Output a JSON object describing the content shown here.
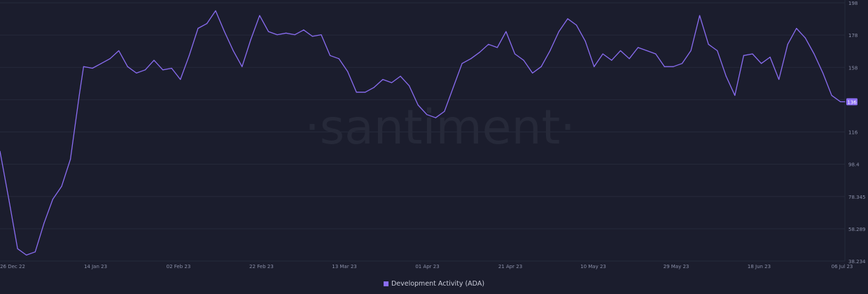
{
  "watermark": "·santiment·",
  "colors": {
    "series": "#8a6df2",
    "background": "#1b1d2d",
    "grid": "#262a3b",
    "text": "#8a8fa8",
    "last_value_bg": "#8a6df2"
  },
  "chart_data": {
    "type": "line",
    "title": "",
    "xlabel": "",
    "ylabel": "",
    "ylim": [
      36.234,
      198
    ],
    "y_ticks": [
      "198",
      "178",
      "158",
      "138",
      "116",
      "98.4",
      "78.345",
      "58.289",
      "38.234"
    ],
    "x_ticks": [
      "26 Dec 22",
      "14 Jan 23",
      "02 Feb 23",
      "22 Feb 23",
      "13 Mar 23",
      "01 Apr 23",
      "21 Apr 23",
      "10 May 23",
      "29 May 23",
      "18 Jun 23",
      "06 Jul 23"
    ],
    "last_value_label": "136",
    "legend_position": "bottom-center",
    "grid": true,
    "series": [
      {
        "name": "Development Activity (ADA)",
        "x": [
          "2022-12-26",
          "2022-12-28",
          "2022-12-30",
          "2023-01-01",
          "2023-01-03",
          "2023-01-05",
          "2023-01-07",
          "2023-01-09",
          "2023-01-11",
          "2023-01-13",
          "2023-01-14",
          "2023-01-16",
          "2023-01-18",
          "2023-01-20",
          "2023-01-22",
          "2023-01-24",
          "2023-01-26",
          "2023-01-28",
          "2023-01-30",
          "2023-02-01",
          "2023-02-03",
          "2023-02-05",
          "2023-02-07",
          "2023-02-09",
          "2023-02-11",
          "2023-02-13",
          "2023-02-15",
          "2023-02-17",
          "2023-02-19",
          "2023-02-21",
          "2023-02-23",
          "2023-02-25",
          "2023-02-27",
          "2023-03-01",
          "2023-03-03",
          "2023-03-05",
          "2023-03-07",
          "2023-03-09",
          "2023-03-11",
          "2023-03-13",
          "2023-03-15",
          "2023-03-17",
          "2023-03-19",
          "2023-03-21",
          "2023-03-23",
          "2023-03-25",
          "2023-03-27",
          "2023-03-29",
          "2023-03-31",
          "2023-04-02",
          "2023-04-04",
          "2023-04-06",
          "2023-04-08",
          "2023-04-10",
          "2023-04-12",
          "2023-04-14",
          "2023-04-16",
          "2023-04-18",
          "2023-04-20",
          "2023-04-22",
          "2023-04-24",
          "2023-04-26",
          "2023-04-28",
          "2023-04-30",
          "2023-05-02",
          "2023-05-04",
          "2023-05-06",
          "2023-05-08",
          "2023-05-10",
          "2023-05-12",
          "2023-05-14",
          "2023-05-16",
          "2023-05-18",
          "2023-05-20",
          "2023-05-22",
          "2023-05-24",
          "2023-05-26",
          "2023-05-28",
          "2023-05-30",
          "2023-06-01",
          "2023-06-03",
          "2023-06-05",
          "2023-06-07",
          "2023-06-09",
          "2023-06-11",
          "2023-06-13",
          "2023-06-15",
          "2023-06-17",
          "2023-06-19",
          "2023-06-21",
          "2023-06-23",
          "2023-06-25",
          "2023-06-27",
          "2023-06-29",
          "2023-07-01",
          "2023-07-03",
          "2023-07-05",
          "2023-07-06"
        ],
        "values": [
          105,
          75,
          44,
          40,
          42,
          60,
          75,
          83,
          100,
          140,
          158,
          157,
          160,
          163,
          168,
          158,
          154,
          156,
          162,
          156,
          157,
          150,
          165,
          182,
          185,
          193,
          180,
          168,
          158,
          175,
          190,
          180,
          178,
          179,
          178,
          181,
          177,
          178,
          165,
          163,
          155,
          142,
          142,
          145,
          150,
          148,
          152,
          146,
          134,
          128,
          126,
          130,
          145,
          160,
          163,
          167,
          172,
          170,
          180,
          166,
          162,
          154,
          158,
          168,
          180,
          188,
          184,
          174,
          158,
          166,
          162,
          168,
          163,
          170,
          168,
          166,
          158,
          158,
          160,
          168,
          190,
          172,
          168,
          152,
          140,
          165,
          166,
          160,
          164,
          150,
          172,
          182,
          176,
          166,
          154,
          140,
          136,
          136
        ]
      }
    ]
  }
}
